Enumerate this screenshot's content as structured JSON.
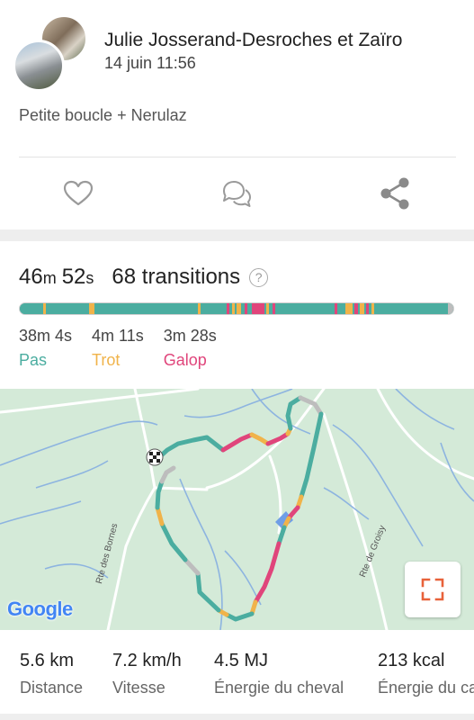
{
  "post": {
    "author": "Julie Josserand-Desroches et Zaïro",
    "date": "14 juin 11:56",
    "description": "Petite boucle + Nerulaz"
  },
  "actions": {
    "like_icon": "heart-outline-icon",
    "comment_icon": "chat-bubbles-icon",
    "share_icon": "share-icon"
  },
  "summary": {
    "duration_min": "46",
    "duration_min_unit": "m",
    "duration_sec": "52",
    "duration_sec_unit": "s",
    "transitions": "68 transitions",
    "help": "?"
  },
  "gaits": [
    {
      "duration": "38m 4s",
      "label": "Pas",
      "color": "#4bada0"
    },
    {
      "duration": "4m 11s",
      "label": "Trot",
      "color": "#f0b34a"
    },
    {
      "duration": "3m 28s",
      "label": "Galop",
      "color": "#e0457b"
    }
  ],
  "map": {
    "road_label_1": "Rte des Bornes",
    "road_label_2": "Rte de Groisy",
    "attribution": "Google"
  },
  "stats": [
    {
      "value": "5.6 km",
      "label": "Distance"
    },
    {
      "value": "7.2 km/h",
      "label": "Vitesse"
    },
    {
      "value": "4.5 MJ",
      "label": "Énergie du cheval"
    },
    {
      "value": "213 kcal",
      "label": "Énergie du cavalier"
    }
  ]
}
